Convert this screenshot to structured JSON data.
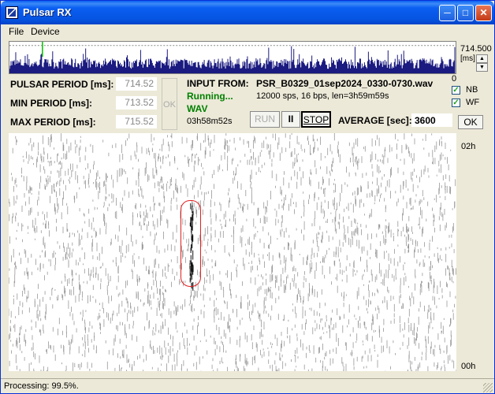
{
  "window": {
    "title": "Pulsar RX"
  },
  "menu": {
    "items": [
      {
        "label": "File",
        "accel": "F"
      },
      {
        "label": "Device",
        "accel": "D"
      }
    ]
  },
  "spectrum": {
    "readout": "714.500",
    "unit": "[ms]",
    "zero": "0"
  },
  "params": {
    "pulsar_period_label": "PULSAR PERIOD [ms]:",
    "pulsar_period_value": "714.52",
    "min_period_label": "MIN PERIOD [ms]:",
    "min_period_value": "713.52",
    "max_period_label": "MAX PERIOD [ms]:",
    "max_period_value": "715.52",
    "ok_label": "OK"
  },
  "input": {
    "label": "INPUT FROM:",
    "file": "PSR_B0329_01sep2024_0330-0730.wav",
    "meta": "12000 sps, 16 bps, len=3h59m59s",
    "status": "Running...",
    "format": "WAV",
    "elapsed": "03h58m52s"
  },
  "controls": {
    "run": "RUN",
    "pause": "II",
    "stop": "STOP",
    "average_label": "AVERAGE [sec]:",
    "average_value": "3600",
    "ok": "OK"
  },
  "options": {
    "nb_label": "NB",
    "nb_checked": true,
    "wf_label": "WF",
    "wf_checked": true
  },
  "waterfall": {
    "time_top": "02h",
    "time_bottom": "00h"
  },
  "status": {
    "text": "Processing: 99.5%."
  }
}
